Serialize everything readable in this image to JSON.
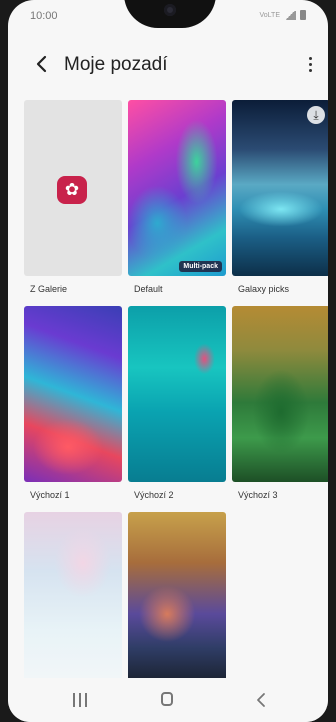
{
  "status": {
    "time": "10:00",
    "network_label": "VoLTE"
  },
  "header": {
    "title": "Moje pozadí"
  },
  "wallpapers": [
    {
      "caption": "Z Galerie"
    },
    {
      "caption": "Default",
      "badge": "Multi-pack"
    },
    {
      "caption": "Galaxy picks"
    },
    {
      "caption": "Výchozí 1"
    },
    {
      "caption": "Výchozí 2"
    },
    {
      "caption": "Výchozí 3"
    },
    {
      "caption": ""
    },
    {
      "caption": ""
    }
  ],
  "icons": {
    "back": "back-arrow-icon",
    "more": "more-vertical-icon",
    "gallery": "flower-gallery-icon",
    "download": "download-icon",
    "nav_recent": "recent-apps-icon",
    "nav_home": "home-icon",
    "nav_back": "nav-back-icon"
  },
  "colors": {
    "gallery_icon": "#c8224b",
    "background": "#f7f7f7"
  }
}
